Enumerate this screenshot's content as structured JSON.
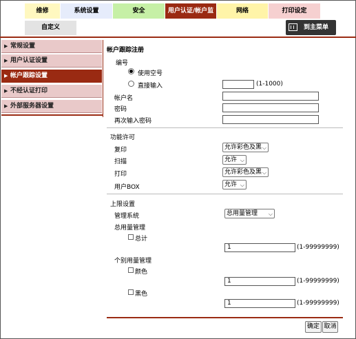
{
  "tabs": [
    {
      "label": "维修",
      "bg": "#fff8c0"
    },
    {
      "label": "系统设置",
      "bg": "#e6ecfb"
    },
    {
      "label": "安全",
      "bg": "#c6f0a6"
    },
    {
      "label": "用户认证/帐户监控",
      "bg": "#9a2a12",
      "active": true
    },
    {
      "label": "网络",
      "bg": "#fff4a8"
    },
    {
      "label": "打印设定",
      "bg": "#f6d0d0"
    }
  ],
  "custom_tab": {
    "label": "自定义",
    "bg": "#e3e3e3"
  },
  "main_menu_button": "到主菜单",
  "sidebar": {
    "items": [
      {
        "label": "常规设置"
      },
      {
        "label": "用户认证设置"
      },
      {
        "label": "帐户跟踪设置",
        "active": true
      },
      {
        "label": "不经认证打印"
      },
      {
        "label": "外部服务器设置"
      }
    ]
  },
  "form": {
    "title": "帐户跟踪注册",
    "number_section": "编号",
    "radio_use_free": "使用空号",
    "radio_direct": "直接输入",
    "number_value": "",
    "number_range": "(1-1000)",
    "account_name_label": "帐户名",
    "account_name_value": "",
    "password_label": "密码",
    "password_value": "",
    "password_confirm_label": "再次输入密码",
    "password_confirm_value": "",
    "permission_title": "功能许可",
    "copy_label": "复印",
    "copy_value": "允许彩色及黑",
    "scan_label": "扫描",
    "scan_value": "允许",
    "print_label": "打印",
    "print_value": "允许彩色及黑",
    "box_label": "用户BOX",
    "box_value": "允许",
    "limit_title": "上限设置",
    "management_label": "管理系统",
    "management_value": "总用量管理",
    "total_section": "总用量管理",
    "total_cb_label": "总计",
    "total_value": "1",
    "range_text": "(1-99999999)",
    "individual_section": "个别用量管理",
    "color_cb_label": "颜色",
    "color_value": "1",
    "black_cb_label": "黑色",
    "black_value": "1",
    "ok_button": "确定",
    "cancel_button": "取消"
  },
  "colors": {
    "accent": "#9a2a12",
    "sidebar_inactive": "#e9c9c9"
  }
}
